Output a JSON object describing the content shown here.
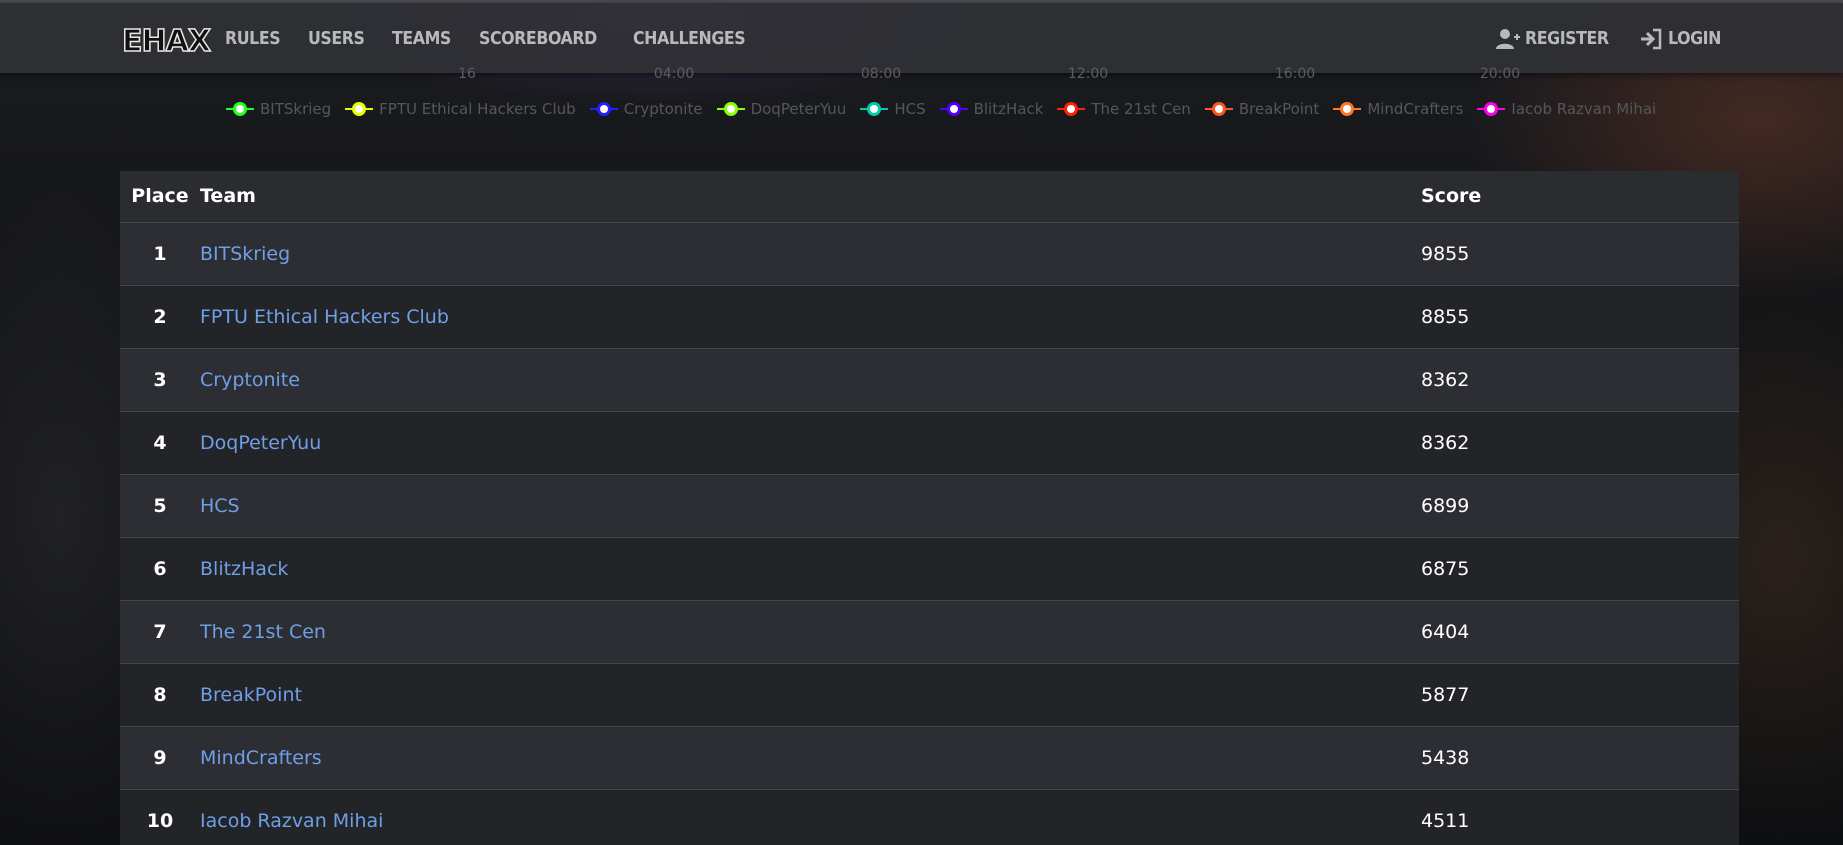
{
  "brand": {
    "logo_text": "EHAX"
  },
  "nav": {
    "links": [
      "RULES",
      "USERS",
      "TEAMS",
      "SCOREBOARD",
      "CHALLENGES"
    ],
    "register_label": "REGISTER",
    "login_label": "LOGIN",
    "register_icon": "user-plus-icon",
    "login_icon": "sign-in-icon"
  },
  "chart": {
    "x_ticks": [
      "16",
      "04:00",
      "08:00",
      "12:00",
      "16:00",
      "20:00"
    ],
    "legend": [
      {
        "name": "BITSkrieg",
        "color": "#22ff22"
      },
      {
        "name": "FPTU Ethical Hackers Club",
        "color": "#e8ff00"
      },
      {
        "name": "Cryptonite",
        "color": "#2222ff"
      },
      {
        "name": "DoqPeterYuu",
        "color": "#88ff00"
      },
      {
        "name": "HCS",
        "color": "#00ccaa"
      },
      {
        "name": "BlitzHack",
        "color": "#5500ff"
      },
      {
        "name": "The 21st Cen",
        "color": "#ff2200"
      },
      {
        "name": "BreakPoint",
        "color": "#ff5522"
      },
      {
        "name": "MindCrafters",
        "color": "#ff7722"
      },
      {
        "name": "Iacob Razvan Mihai",
        "color": "#ff00ee"
      }
    ]
  },
  "table": {
    "headers": {
      "place": "Place",
      "team": "Team",
      "score": "Score"
    },
    "rows": [
      {
        "place": "1",
        "team": "BITSkrieg",
        "score": "9855"
      },
      {
        "place": "2",
        "team": "FPTU Ethical Hackers Club",
        "score": "8855"
      },
      {
        "place": "3",
        "team": "Cryptonite",
        "score": "8362"
      },
      {
        "place": "4",
        "team": "DoqPeterYuu",
        "score": "8362"
      },
      {
        "place": "5",
        "team": "HCS",
        "score": "6899"
      },
      {
        "place": "6",
        "team": "BlitzHack",
        "score": "6875"
      },
      {
        "place": "7",
        "team": "The 21st Cen",
        "score": "6404"
      },
      {
        "place": "8",
        "team": "BreakPoint",
        "score": "5877"
      },
      {
        "place": "9",
        "team": "MindCrafters",
        "score": "5438"
      },
      {
        "place": "10",
        "team": "Iacob Razvan Mihai",
        "score": "4511"
      }
    ]
  }
}
